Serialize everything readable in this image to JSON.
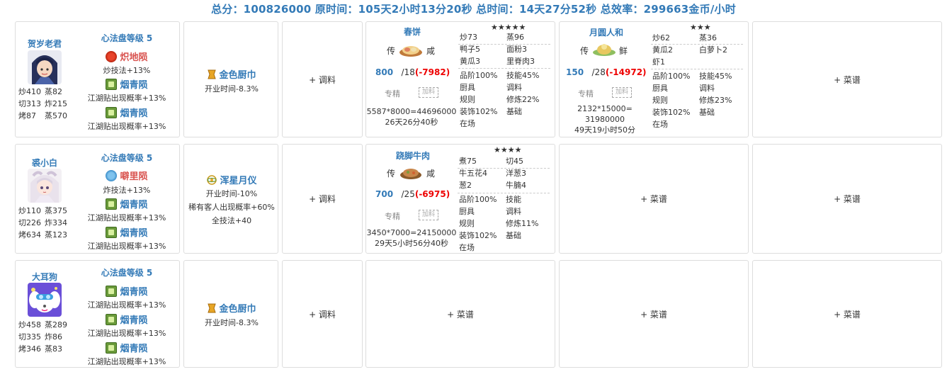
{
  "summary": "总分：100826000 原时间：105天2小时13分20秒 总时间：14天27分52秒 总效率：299663金币/小时",
  "rows": [
    {
      "chef": {
        "name": "贺岁老君",
        "avatar": "chef-avatar-elder",
        "stats": [
          [
            "炒410",
            "蒸82"
          ],
          [
            "切313",
            "炸215"
          ],
          [
            "烤87",
            "蒸570"
          ]
        ],
        "disk_level": "心法盘等级 5",
        "gems": [
          {
            "icon": "red-gem-icon",
            "name": "炽地陨",
            "color": "#d9534f",
            "desc": "炒技法+13%"
          },
          {
            "icon": "green-gem-icon",
            "name": "烟青陨",
            "color": "#337ab7",
            "desc": "江湖贴出现概率+13%"
          },
          {
            "icon": "green-gem-icon",
            "name": "烟青陨",
            "color": "#337ab7",
            "desc": "江湖贴出现概率+13%"
          }
        ]
      },
      "equip": {
        "name": "金色厨巾",
        "desc": [
          "开业时间-8.3%"
        ]
      },
      "condiment": "+ 调料",
      "recipes": [
        {
          "name": "春饼",
          "stars": "★★★★★",
          "rarity": "传",
          "taste": "咸",
          "qty": "800",
          "max": "/18",
          "diff": "(-7982)",
          "zj": "专精",
          "add": "加料",
          "calc": [
            "5587*8000=44696000",
            "26天26分40秒"
          ],
          "ingredients": [
            [
              "炒73",
              "蒸96"
            ],
            [
              "鸭子5",
              "面粉3"
            ],
            [
              "黄瓜3",
              "里脊肉3"
            ]
          ],
          "info": [
            [
              "品阶100%",
              "技能45%"
            ],
            [
              "厨具",
              "调料"
            ],
            [
              "规则",
              "修炼22%"
            ],
            [
              "装饰102%",
              "基础"
            ],
            [
              "在场",
              ""
            ]
          ]
        },
        {
          "name": "月圆人和",
          "stars": "★★★",
          "rarity": "传",
          "taste": "鲜",
          "qty": "150",
          "max": "/28",
          "diff": "(-14972)",
          "zj": "专精",
          "add": "加料",
          "calc": [
            "2132*15000=",
            "31980000",
            "49天19小时50分"
          ],
          "ingredients": [
            [
              "炒62",
              "蒸36"
            ],
            [
              "黄瓜2",
              "白萝卜2"
            ],
            [
              "虾1",
              ""
            ]
          ],
          "info": [
            [
              "品阶100%",
              "技能45%"
            ],
            [
              "厨具",
              "调料"
            ],
            [
              "规则",
              "修炼23%"
            ],
            [
              "装饰102%",
              "基础"
            ],
            [
              "在场",
              ""
            ]
          ]
        }
      ],
      "empty_recipe": "+ 菜谱"
    },
    {
      "chef": {
        "name": "裘小白",
        "avatar": "chef-avatar-girl",
        "stats": [
          [
            "炒110",
            "蒸375"
          ],
          [
            "切226",
            "炸334"
          ],
          [
            "烤634",
            "蒸123"
          ]
        ],
        "disk_level": "心法盘等级 5",
        "gems": [
          {
            "icon": "blue-gem-icon",
            "name": "噼里陨",
            "color": "#d9534f",
            "desc": "炸技法+13%"
          },
          {
            "icon": "green-gem-icon",
            "name": "烟青陨",
            "color": "#337ab7",
            "desc": "江湖贴出现概率+13%"
          },
          {
            "icon": "green-gem-icon",
            "name": "烟青陨",
            "color": "#337ab7",
            "desc": "江湖贴出现概率+13%"
          }
        ]
      },
      "equip": {
        "name": "浑星月仪",
        "desc": [
          "开业时间-10%",
          "稀有客人出现概率+60%",
          "全技法+40"
        ]
      },
      "condiment": "+ 调料",
      "recipes": [
        {
          "name": "跷脚牛肉",
          "stars": "★★★★",
          "rarity": "传",
          "taste": "咸",
          "qty": "700",
          "max": "/25",
          "diff": "(-6975)",
          "zj": "专精",
          "add": "加料",
          "calc": [
            "3450*7000=24150000",
            "29天5小时56分40秒"
          ],
          "ingredients": [
            [
              "煮75",
              "切45"
            ],
            [
              "牛五花4",
              "洋葱3"
            ],
            [
              "葱2",
              "牛腩4"
            ]
          ],
          "info": [
            [
              "品阶100%",
              "技能"
            ],
            [
              "厨具",
              "调料"
            ],
            [
              "规则",
              "修炼11%"
            ],
            [
              "装饰102%",
              "基础"
            ],
            [
              "在场",
              ""
            ]
          ]
        }
      ],
      "empty_recipe": "+ 菜谱"
    },
    {
      "chef": {
        "name": "大耳狗",
        "avatar": "chef-avatar-dog",
        "stats": [
          [
            "炒458",
            "蒸289"
          ],
          [
            "切335",
            "炸86"
          ],
          [
            "烤346",
            "蒸83"
          ]
        ],
        "disk_level": "心法盘等级 5",
        "gems": [
          {
            "icon": "green-gem-icon",
            "name": "烟青陨",
            "color": "#337ab7",
            "desc": "江湖贴出现概率+13%"
          },
          {
            "icon": "green-gem-icon",
            "name": "烟青陨",
            "color": "#337ab7",
            "desc": "江湖贴出现概率+13%"
          },
          {
            "icon": "green-gem-icon",
            "name": "烟青陨",
            "color": "#337ab7",
            "desc": "江湖贴出现概率+13%"
          }
        ]
      },
      "equip": {
        "name": "金色厨巾",
        "desc": [
          "开业时间-8.3%"
        ]
      },
      "condiment": "+ 调料",
      "recipes": [],
      "empty_recipe": "+ 菜谱"
    }
  ]
}
